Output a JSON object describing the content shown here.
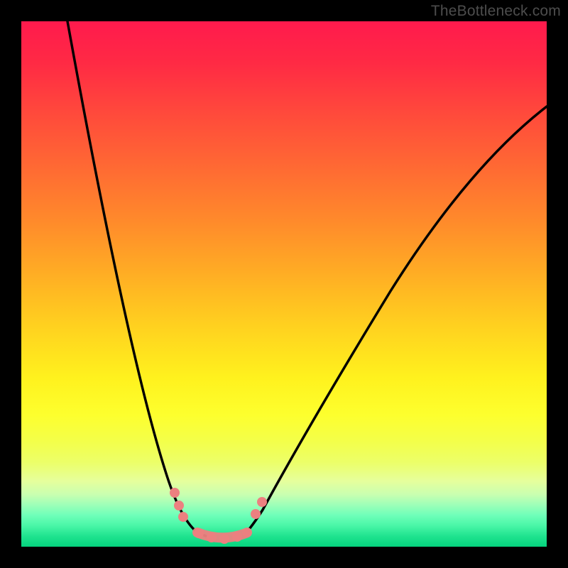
{
  "watermark": "TheBottleneck.com",
  "chart_data": {
    "type": "line",
    "title": "",
    "xlabel": "",
    "ylabel": "",
    "xlim": [
      0,
      100
    ],
    "ylim": [
      0,
      100
    ],
    "grid": false,
    "legend": false,
    "background_gradient": {
      "direction": "vertical",
      "stops": [
        {
          "pos": 0,
          "color": "#ff1a4d"
        },
        {
          "pos": 25,
          "color": "#ff6a2f"
        },
        {
          "pos": 50,
          "color": "#ffc020"
        },
        {
          "pos": 70,
          "color": "#fff21e"
        },
        {
          "pos": 88,
          "color": "#e6ff9c"
        },
        {
          "pos": 100,
          "color": "#05d47e"
        }
      ]
    },
    "series": [
      {
        "name": "left-branch",
        "color": "#000000",
        "x": [
          9,
          12,
          16,
          20,
          24,
          28,
          31,
          33,
          35
        ],
        "y": [
          100,
          80,
          60,
          42,
          27,
          14,
          6,
          3,
          2
        ]
      },
      {
        "name": "right-branch",
        "color": "#000000",
        "x": [
          43,
          46,
          50,
          56,
          64,
          74,
          86,
          100
        ],
        "y": [
          3,
          7,
          13,
          23,
          38,
          55,
          72,
          84
        ]
      },
      {
        "name": "optimal-zone",
        "color": "#ec8080",
        "style": "thick-round",
        "x": [
          33,
          35,
          37,
          39,
          41,
          43
        ],
        "y": [
          3,
          1.5,
          1,
          1,
          1.5,
          3
        ]
      }
    ],
    "markers": [
      {
        "series": "left-branch",
        "x": 29,
        "y": 10,
        "color": "#ec8080"
      },
      {
        "series": "left-branch",
        "x": 30,
        "y": 8,
        "color": "#ec8080"
      },
      {
        "series": "left-branch",
        "x": 31,
        "y": 6,
        "color": "#ec8080"
      },
      {
        "series": "right-branch",
        "x": 45,
        "y": 6,
        "color": "#ec8080"
      },
      {
        "series": "right-branch",
        "x": 46,
        "y": 8,
        "color": "#ec8080"
      },
      {
        "series": "optimal-zone",
        "x": 34,
        "y": 2.5,
        "color": "#ec8080"
      },
      {
        "series": "optimal-zone",
        "x": 36,
        "y": 1.5,
        "color": "#ec8080"
      },
      {
        "series": "optimal-zone",
        "x": 39,
        "y": 1,
        "color": "#ec8080"
      },
      {
        "series": "optimal-zone",
        "x": 41,
        "y": 1.5,
        "color": "#ec8080"
      },
      {
        "series": "optimal-zone",
        "x": 43,
        "y": 2.5,
        "color": "#ec8080"
      }
    ],
    "annotations": []
  }
}
